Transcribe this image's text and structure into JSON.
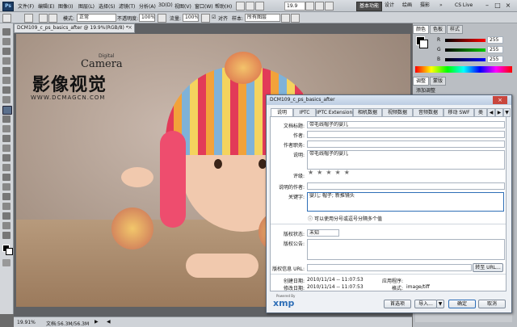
{
  "menubar": {
    "logo": "Ps",
    "items": [
      "文件(F)",
      "编辑(E)",
      "图像(I)",
      "图层(L)",
      "选择(S)",
      "滤镜(T)",
      "分析(A)",
      "3D(D)",
      "视图(V)",
      "窗口(W)",
      "帮助(H)"
    ],
    "zoom_value": "19.9",
    "workspaces": [
      "基本功能",
      "设计",
      "绘画",
      "摄影"
    ],
    "cslive": "CS Live"
  },
  "options": {
    "mode_label": "模式:",
    "mode_value": "正常",
    "opacity_label": "不透明度:",
    "opacity_value": "100%",
    "flow_label": "流量:",
    "flow_value": "100%",
    "align_label": "对齐",
    "sample_label": "样本:",
    "sample_value": "所有图层"
  },
  "document": {
    "tab_title": "DCM109_c_ps_basics_after @ 19.9%(RGB/8) *",
    "watermark_cn": "影像视觉",
    "watermark_en": "Camera",
    "watermark_small": "Digital",
    "watermark_url": "WWW.DCMAGCN.COM",
    "status_zoom": "19.91%",
    "status_doc": "文档:56.3M/56.3M"
  },
  "panels": {
    "color_tabs": [
      "颜色",
      "色板",
      "样式"
    ],
    "channels": [
      "R",
      "G",
      "B"
    ],
    "channel_values": [
      "255",
      "255",
      "255"
    ],
    "adjust_tabs": [
      "调整",
      "蒙版"
    ],
    "adjust_title": "添加调整"
  },
  "dialog": {
    "title": "DCM109_c_ps_basics_after",
    "tabs": [
      "说明",
      "IPTC",
      "IPTC Extension",
      "相机数据",
      "视频数据",
      "音频数据",
      "移动 SWF",
      "类"
    ],
    "fields": {
      "doc_title_label": "文档标题:",
      "doc_title_value": "带毛线帽子的婴儿",
      "author_label": "作者:",
      "author_title_label": "作者职务:",
      "desc_label": "说明:",
      "desc_value": "带毛线帽子的婴儿",
      "rating_label": "评级:",
      "desc_writer_label": "说明的作者:",
      "keywords_label": "关键字:",
      "keywords_value": "婴儿; 帽子; 新推镜头",
      "keywords_hint": "可以使用分号或逗号分隔多个值",
      "copyright_status_label": "版权状态:",
      "copyright_status_value": "未知",
      "copyright_notice_label": "版权公告:",
      "copyright_url_label": "版权信息 URL:",
      "goto_url": "转至 URL...",
      "created_label": "创建日期:",
      "created_value": "2010/11/14 -- 11:07:53",
      "modified_label": "修改日期:",
      "modified_value": "2010/11/14 -- 11:07:53",
      "app_label": "应用程序:",
      "format_label": "格式:",
      "format_value": "image/tiff"
    },
    "xmp_powered": "Powered By",
    "xmp_logo": "xmp",
    "buttons": {
      "prefs": "首选项",
      "import": "导入...",
      "ok": "确定",
      "cancel": "取消"
    }
  },
  "colors": {
    "accent": "#2f6fb7",
    "ok_border": "#2f6fb7"
  }
}
